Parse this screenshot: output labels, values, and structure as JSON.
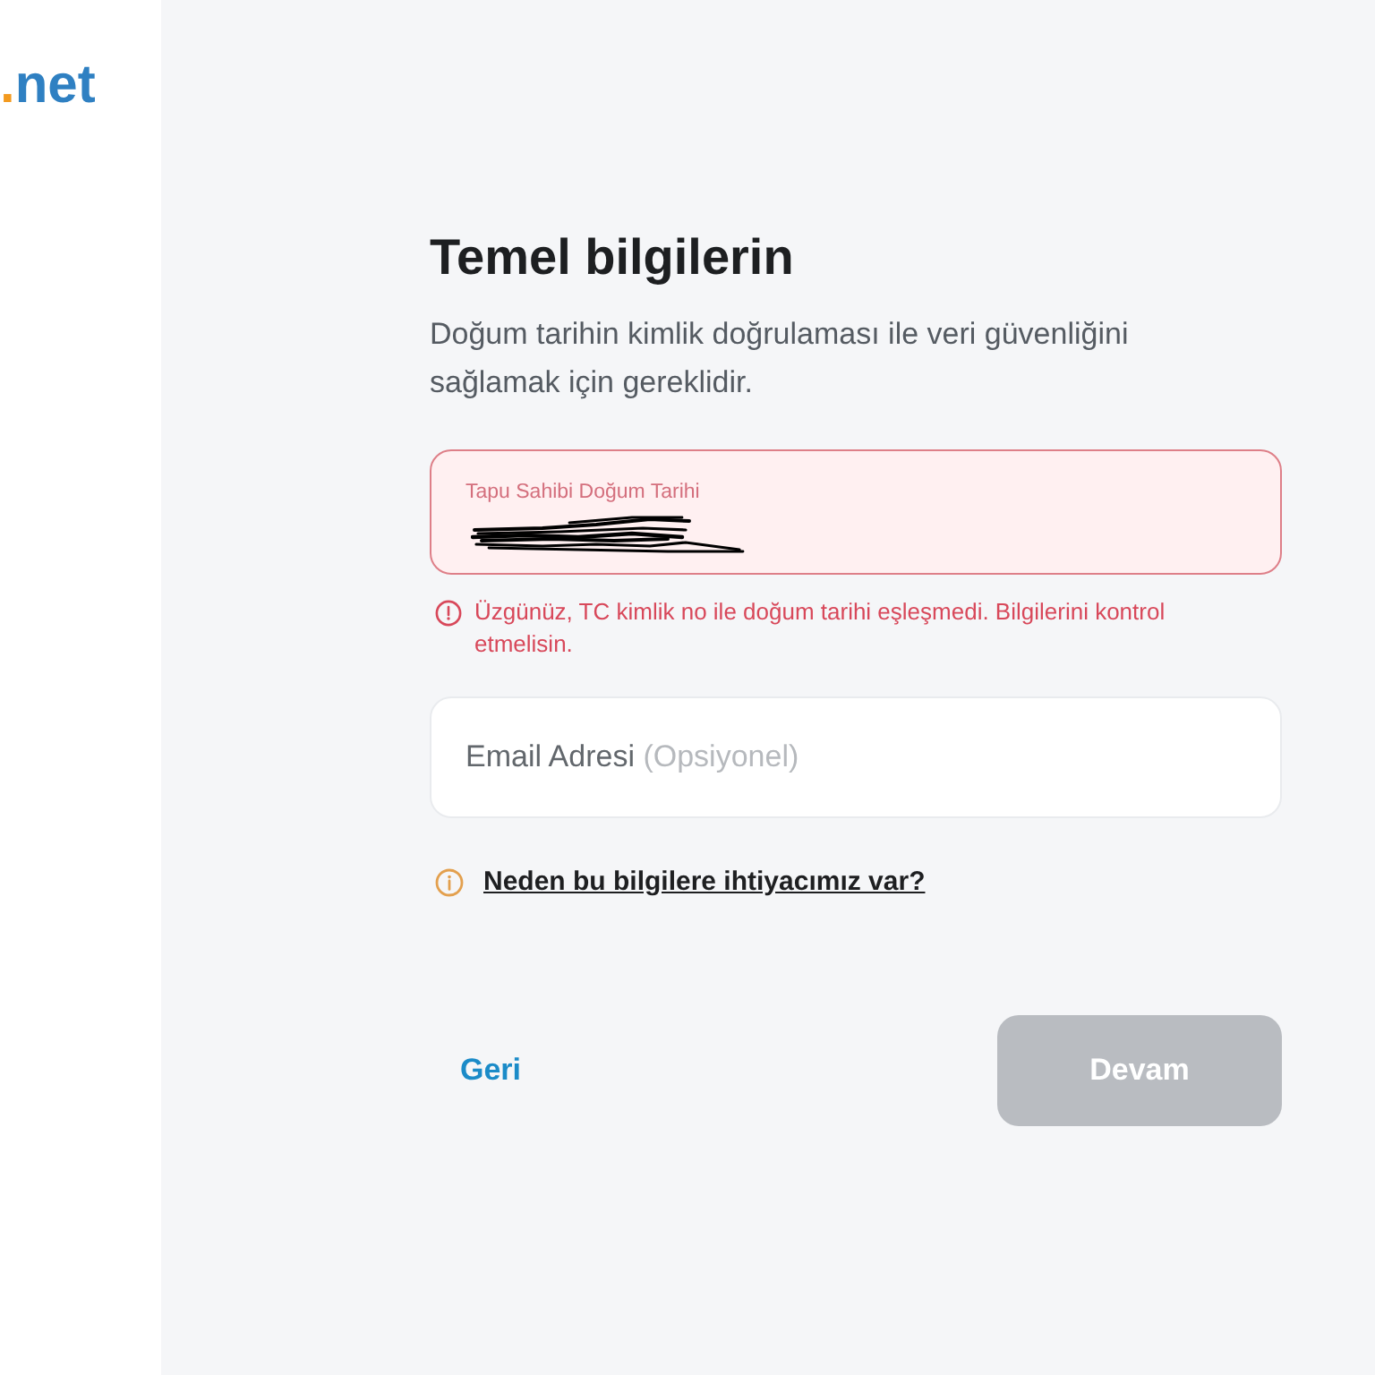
{
  "sidebar": {
    "logo": [
      {
        "text": ".",
        "color": "#f39a1f"
      },
      {
        "text": "net",
        "color": "#2f80c2"
      }
    ]
  },
  "form": {
    "title": "Temel bilgilerin",
    "description": "Doğum tarihin kimlik doğrulaması ile veri güvenliğini sağlamak için gereklidir.",
    "fields": [
      {
        "kind": "date",
        "label": "Tapu Sahibi Doğum Tarihi",
        "redacted": true,
        "error": true,
        "error_message": "Üzgünüz, TC kimlik no ile doğum tarihi eşleşmedi. Bilgilerini kontrol etmelisin."
      },
      {
        "kind": "email",
        "label": "Email Adresi",
        "optional_note": "(Opsiyonel)",
        "error": false
      }
    ],
    "info_link": "Neden bu bilgilere ihtiyacımız var?"
  },
  "actions": {
    "back": "Geri",
    "continue": {
      "label": "Devam",
      "disabled": true
    }
  }
}
